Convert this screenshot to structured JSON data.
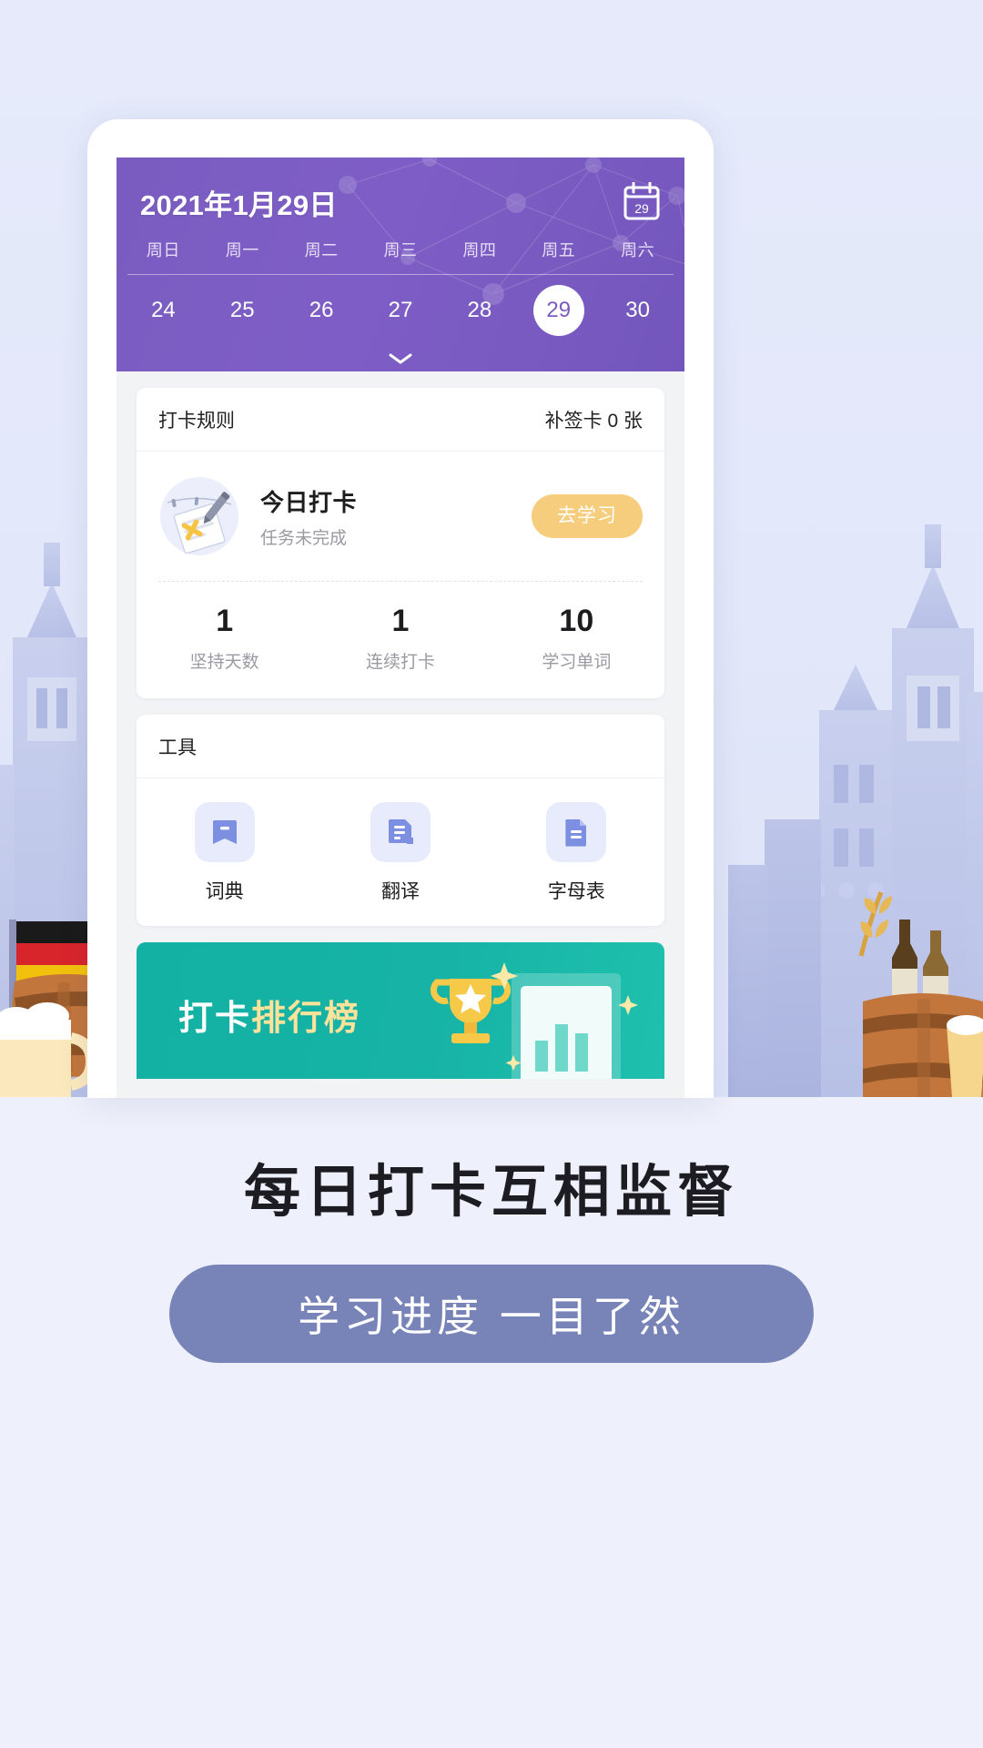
{
  "app": {
    "header": {
      "date_title": "2021年1月29日",
      "calendar_icon_day": "29",
      "weekdays": [
        "周日",
        "周一",
        "周二",
        "周三",
        "周四",
        "周五",
        "周六"
      ],
      "dates": [
        "24",
        "25",
        "26",
        "27",
        "28",
        "29",
        "30"
      ],
      "selected_date": "29",
      "expand_icon": "chevron-down-icon"
    },
    "checkin_card": {
      "rules_label": "打卡规则",
      "makeup_cards": "补签卡 0 张",
      "today_title": "今日打卡",
      "today_status": "任务未完成",
      "action_button": "去学习",
      "stats": [
        {
          "value": "1",
          "label": "坚持天数"
        },
        {
          "value": "1",
          "label": "连续打卡"
        },
        {
          "value": "10",
          "label": "学习单词"
        }
      ]
    },
    "tools_card": {
      "title": "工具",
      "items": [
        {
          "label": "词典",
          "icon": "book-icon"
        },
        {
          "label": "翻译",
          "icon": "translate-document-icon"
        },
        {
          "label": "字母表",
          "icon": "document-icon"
        }
      ]
    },
    "banner": {
      "title_part1": "打卡",
      "title_part2": "排行榜",
      "icon": "trophy-icon"
    }
  },
  "marketing": {
    "tagline": "每日打卡互相监督",
    "subline": "学习进度  一目了然"
  },
  "colors": {
    "header_purple": "#7a5cc0",
    "accent_orange": "#f6cd7d",
    "banner_teal": "#12b1a4",
    "pill_blue": "#7884b8",
    "tool_icon_bg": "#e7ebfb",
    "tool_icon_fg": "#7d8fe0",
    "page_bg": "#e8ecfa"
  }
}
